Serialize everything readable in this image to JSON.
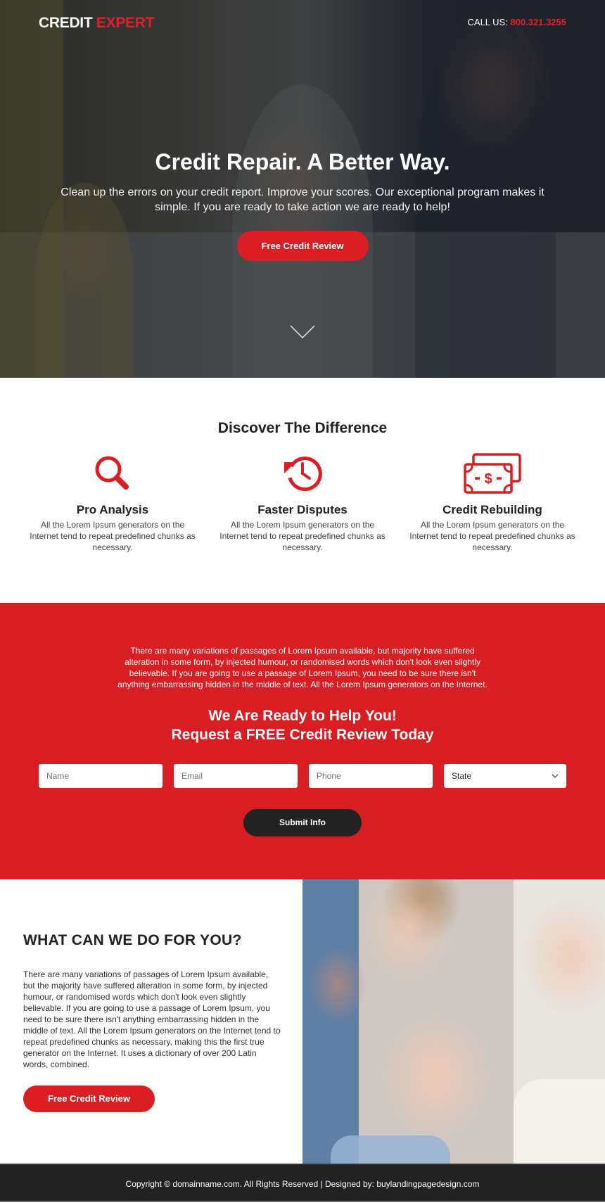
{
  "header": {
    "logo_part1": "CREDIT",
    "logo_part2": "EXPERT",
    "call_label": "CALL US:",
    "phone": "800.321.3255"
  },
  "hero": {
    "title": "Credit Repair. A Better Way.",
    "subtitle": "Clean up the errors on your credit report. Improve your scores. Our exceptional program makes it simple. If you are ready to take action we are ready to help!",
    "cta_label": "Free Credit Review",
    "scroll_icon": "chevron-down-icon"
  },
  "discover": {
    "title": "Discover The Difference",
    "features": [
      {
        "icon": "magnifier-icon",
        "title": "Pro Analysis",
        "text": "All the Lorem Ipsum generators on the Internet tend to repeat predefined chunks as necessary."
      },
      {
        "icon": "history-clock-icon",
        "title": "Faster Disputes",
        "text": "All the Lorem Ipsum generators on the Internet tend to repeat predefined chunks as necessary."
      },
      {
        "icon": "money-bills-icon",
        "title": "Credit Rebuilding",
        "text": "All the Lorem Ipsum generators on the Internet tend to repeat predefined chunks as necessary."
      }
    ]
  },
  "lead_form": {
    "intro": "There are many variations of passages of Lorem Ipsum available, but majority have suffered alteration in some form, by injected humour, or randomised words which don't look even slightly believable. If you are going to use a passage of Lorem Ipsum, you need to be sure there isn't anything embarrassing hidden in the middle of text. All the Lorem Ipsum generators on the Internet.",
    "title_line1": "We Are Ready to Help You!",
    "title_line2": "Request a FREE Credit Review Today",
    "name_placeholder": "Name",
    "email_placeholder": "Email",
    "phone_placeholder": "Phone",
    "state_selected": "State",
    "submit_label": "Submit Info"
  },
  "what": {
    "title": "WHAT CAN WE DO FOR YOU?",
    "text": "There are many variations of passages of Lorem Ipsum available, but the majority have suffered alteration in some form, by injected humour, or randomised words which don't look even slightly believable. If you are going to use a passage of Lorem Ipsum, you need to be sure there isn't anything embarrassing hidden in the middle of text. All the Lorem Ipsum generators on the Internet tend to repeat predefined chunks as necessary, making this the first true generator on the Internet. It uses a dictionary of over 200 Latin words, combined.",
    "cta_label": "Free Credit Review"
  },
  "footer": {
    "text": "Copyright © domainname.com. All Rights Reserved | Designed by: buylandingpagedesign.com"
  },
  "colors": {
    "accent": "#da1e24",
    "dark": "#222222"
  }
}
